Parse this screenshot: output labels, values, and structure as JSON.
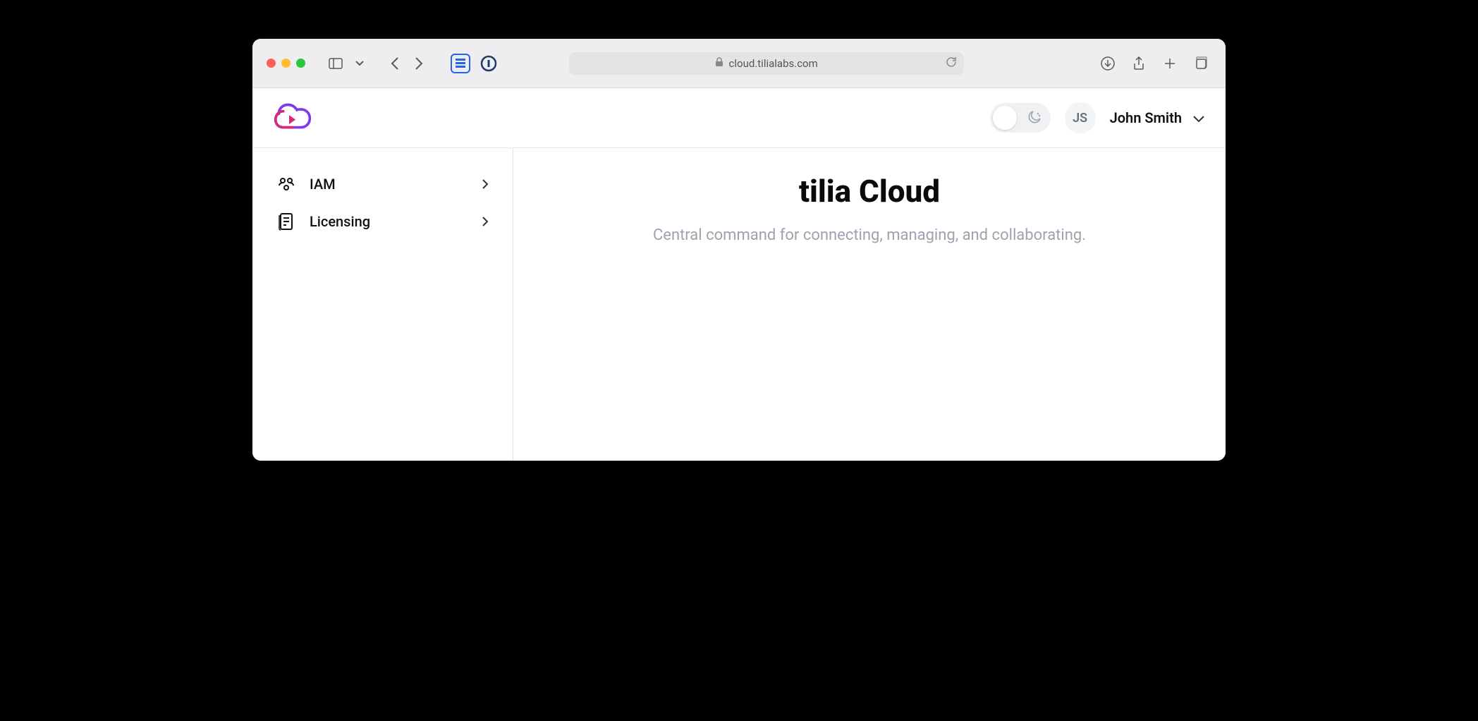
{
  "browser": {
    "url": "cloud.tilialabs.com"
  },
  "header": {
    "user_initials": "JS",
    "user_name": "John Smith"
  },
  "sidebar": {
    "items": [
      {
        "label": "IAM"
      },
      {
        "label": "Licensing"
      }
    ]
  },
  "main": {
    "title": "tilia Cloud",
    "subtitle": "Central command for connecting, managing, and collaborating."
  }
}
